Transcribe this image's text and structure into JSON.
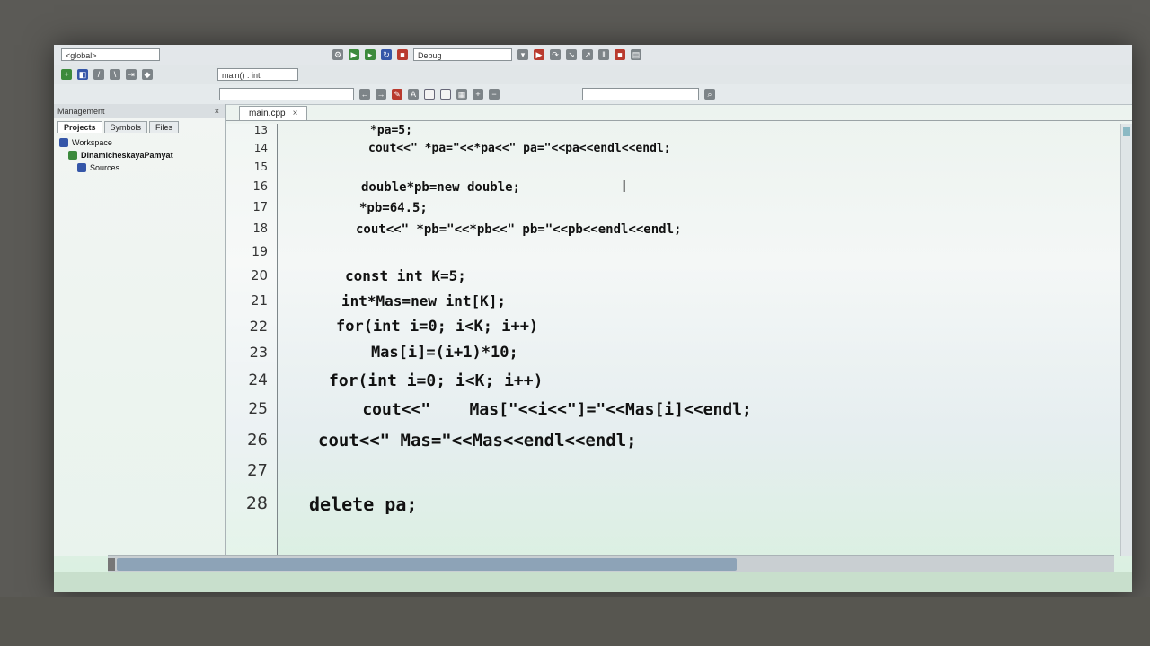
{
  "toolbar": {
    "scope_combo": "<global>",
    "build_target": "Debug",
    "function_combo": "main() : int"
  },
  "management": {
    "title": "Management",
    "close_label": "×",
    "tabs": [
      "Projects",
      "Symbols",
      "Files"
    ],
    "tree": [
      {
        "label": "Workspace",
        "icon": "workspace-icon"
      },
      {
        "label": "DinamicheskayaPamyat",
        "icon": "project-icon"
      },
      {
        "label": "Sources",
        "icon": "folder-icon"
      }
    ]
  },
  "editor": {
    "file_tab": "main.cpp",
    "file_tab_close": "×",
    "lines": [
      {
        "n": "13",
        "text": "*pa=5;"
      },
      {
        "n": "14",
        "text": "cout<<\" *pa=\"<<*pa<<\" pa=\"<<pa<<endl<<endl;"
      },
      {
        "n": "15",
        "text": ""
      },
      {
        "n": "16",
        "text": "double*pb=new double;"
      },
      {
        "n": "17",
        "text": "*pb=64.5;"
      },
      {
        "n": "18",
        "text": "cout<<\" *pb=\"<<*pb<<\" pb=\"<<pb<<endl<<endl;"
      },
      {
        "n": "19",
        "text": ""
      },
      {
        "n": "20",
        "text": "const int K=5;"
      },
      {
        "n": "21",
        "text": "int*Mas=new int[K];"
      },
      {
        "n": "22",
        "text": "for(int i=0; i<K; i++)"
      },
      {
        "n": "23",
        "text": "    Mas[i]=(i+1)*10;"
      },
      {
        "n": "24",
        "text": "for(int i=0; i<K; i++)"
      },
      {
        "n": "25",
        "text": "    cout<<\"    Mas[\"<<i<<\"]=\"<<Mas[i]<<endl;"
      },
      {
        "n": "26",
        "text": "cout<<\" Mas=\"<<Mas<<endl<<endl;"
      },
      {
        "n": "27",
        "text": ""
      },
      {
        "n": "28",
        "text": "delete pa;"
      }
    ]
  },
  "search": {
    "value": ""
  }
}
